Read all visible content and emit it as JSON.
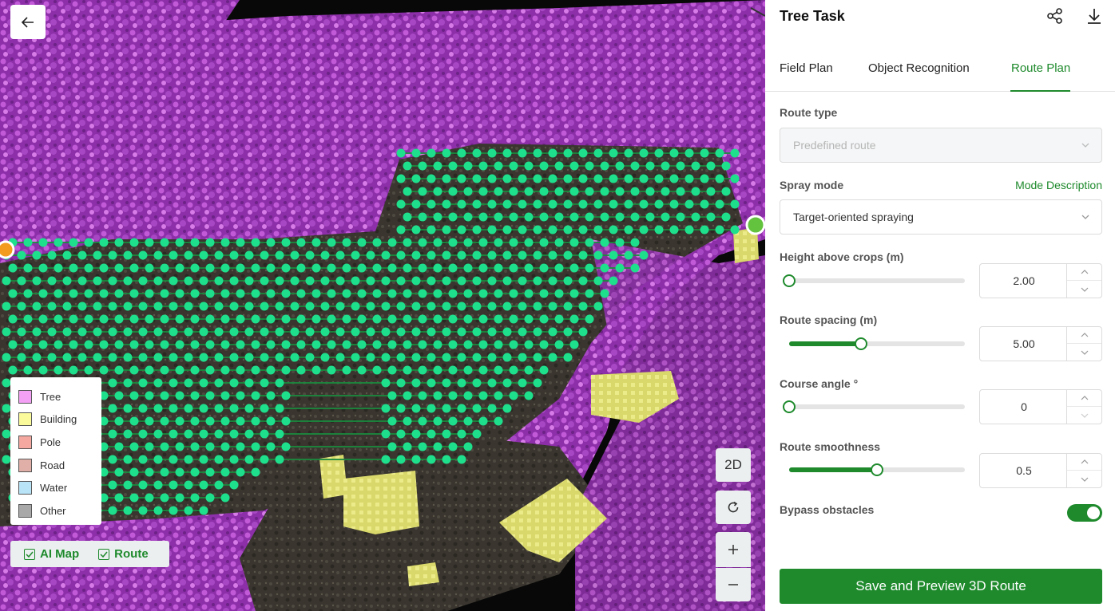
{
  "map": {
    "legend": [
      {
        "label": "Tree",
        "color": "#f4a0f4"
      },
      {
        "label": "Building",
        "color": "#fbfb9c"
      },
      {
        "label": "Pole",
        "color": "#f5a8a0"
      },
      {
        "label": "Road",
        "color": "#e0b0a8"
      },
      {
        "label": "Water",
        "color": "#b9e4f7"
      },
      {
        "label": "Other",
        "color": "#a8a8a8"
      }
    ],
    "layers": {
      "ai_map": "AI Map",
      "route": "Route"
    },
    "controls": {
      "view_2d": "2D"
    }
  },
  "panel": {
    "title": "Tree Task",
    "tabs": [
      {
        "label": "Field Plan"
      },
      {
        "label": "Object Recognition"
      },
      {
        "label": "Route Plan",
        "active": true
      }
    ],
    "route_type": {
      "label": "Route type",
      "value": "Predefined route"
    },
    "spray_mode": {
      "label": "Spray mode",
      "link": "Mode Description",
      "value": "Target-oriented spraying"
    },
    "height": {
      "label": "Height above crops (m)",
      "value": "2.00",
      "fraction": 0.0
    },
    "spacing": {
      "label": "Route spacing (m)",
      "value": "5.00",
      "fraction": 0.41
    },
    "angle": {
      "label": "Course angle °",
      "value": "0",
      "fraction": 0.0
    },
    "smoothness": {
      "label": "Route smoothness",
      "value": "0.5",
      "fraction": 0.5
    },
    "bypass": {
      "label": "Bypass obstacles",
      "enabled": true
    },
    "save_button": "Save and Preview 3D Route"
  },
  "colors": {
    "accent": "#1e8a2c",
    "tree": "#a43cc0",
    "route_point": "#1ee08c"
  }
}
